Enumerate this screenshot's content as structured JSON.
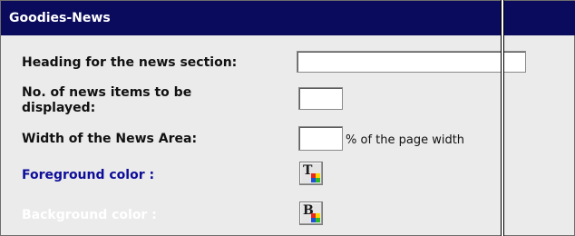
{
  "header": {
    "title": "Goodies-News"
  },
  "form": {
    "heading_label": "Heading for the news section:",
    "heading_value": "",
    "news_count_label_line1": "No. of news items to be",
    "news_count_label_line2": "displayed:",
    "news_count_value": "",
    "width_label": "Width of the News Area:",
    "width_value": "",
    "width_suffix": "% of the page width",
    "foreground_label": "Foreground color :",
    "foreground_button_glyph": "T",
    "background_label": "Background color :",
    "background_button_glyph": "B"
  },
  "colors": {
    "header_bg": "#0b0b5e",
    "panel_bg": "#ebebeb",
    "foreground_label": "#0d0d9a",
    "background_label": "#ffffff"
  }
}
